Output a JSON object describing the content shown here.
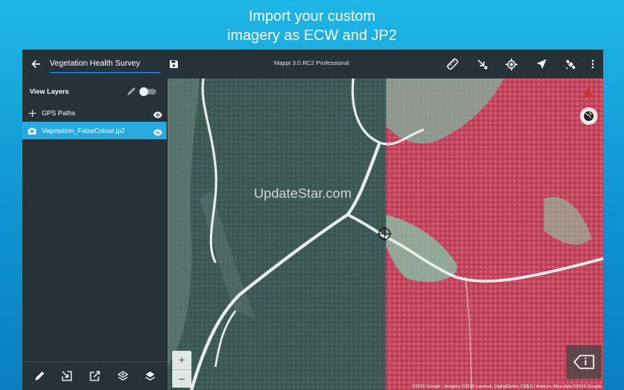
{
  "promo": {
    "line1": "Import your custom",
    "line2": "imagery as ECW and JP2"
  },
  "toolbar": {
    "back_icon": "arrow-back-icon",
    "project_title": "Vegetation Health Survey",
    "save_icon": "save-icon",
    "app_name": "Mappt 3.0.RC2 Professional",
    "actions": [
      {
        "name": "ruler-icon"
      },
      {
        "name": "add-point-icon"
      },
      {
        "name": "gps-target-icon"
      },
      {
        "name": "navigation-arrow-icon"
      },
      {
        "name": "satellite-icon"
      },
      {
        "name": "more-vert-icon"
      }
    ]
  },
  "sidebar": {
    "header": "View Layers",
    "layers": [
      {
        "label": "GPS Paths",
        "icon": "plus-icon",
        "selected": false
      },
      {
        "label": "Vegetation_FalseColour.jp2",
        "icon": "camera-icon",
        "selected": true
      }
    ],
    "bottom_tools": [
      {
        "name": "edit-icon"
      },
      {
        "name": "import-icon"
      },
      {
        "name": "export-icon"
      },
      {
        "name": "layers-add-icon"
      },
      {
        "name": "layers-settings-icon"
      }
    ]
  },
  "map": {
    "watermark": "UpdateStar.com",
    "zoom_in": "+",
    "zoom_out": "−",
    "attribution": "©2016 Google · Imagery ©2016 Landsat, DigitalGlobe, CNES / Astrium, Map data ©2016 Google"
  },
  "colors": {
    "accent": "#29a8e2",
    "toolbar": "#263238",
    "background_top": "#1fb6e6",
    "false_colour_red": "#c94e6a"
  }
}
